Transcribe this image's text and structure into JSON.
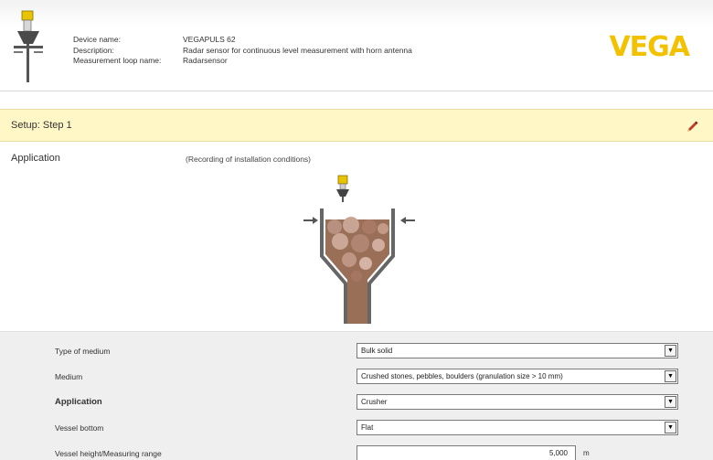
{
  "device": {
    "labels": {
      "name": "Device name:",
      "description": "Description:",
      "loop": "Measurement loop name:"
    },
    "values": {
      "name": "VEGAPULS 62",
      "description": "Radar sensor for continuous level measurement with horn antenna",
      "loop": "Radarsensor"
    }
  },
  "logo": {
    "text": "VEGA",
    "color": "#f2c100"
  },
  "setup": {
    "title": "Setup: Step 1",
    "edit_icon": "pencil-icon"
  },
  "application": {
    "label": "Application",
    "note": "(Recording of installation conditions)"
  },
  "form": {
    "rows": [
      {
        "label": "Type of medium",
        "value": "Bulk solid",
        "kind": "select"
      },
      {
        "label": "Medium",
        "value": "Crushed stones, pebbles, boulders (granulation size > 10 mm)",
        "kind": "select"
      },
      {
        "label": "Application",
        "value": "Crusher",
        "kind": "select"
      },
      {
        "label": "Vessel bottom",
        "value": "Flat",
        "kind": "select"
      },
      {
        "label": "Vessel height/Measuring range",
        "value": "5,000",
        "unit": "m",
        "kind": "input"
      }
    ]
  },
  "colors": {
    "setup_bar": "#fff7c6",
    "form_bg": "#efefef",
    "logo": "#f2c100"
  }
}
